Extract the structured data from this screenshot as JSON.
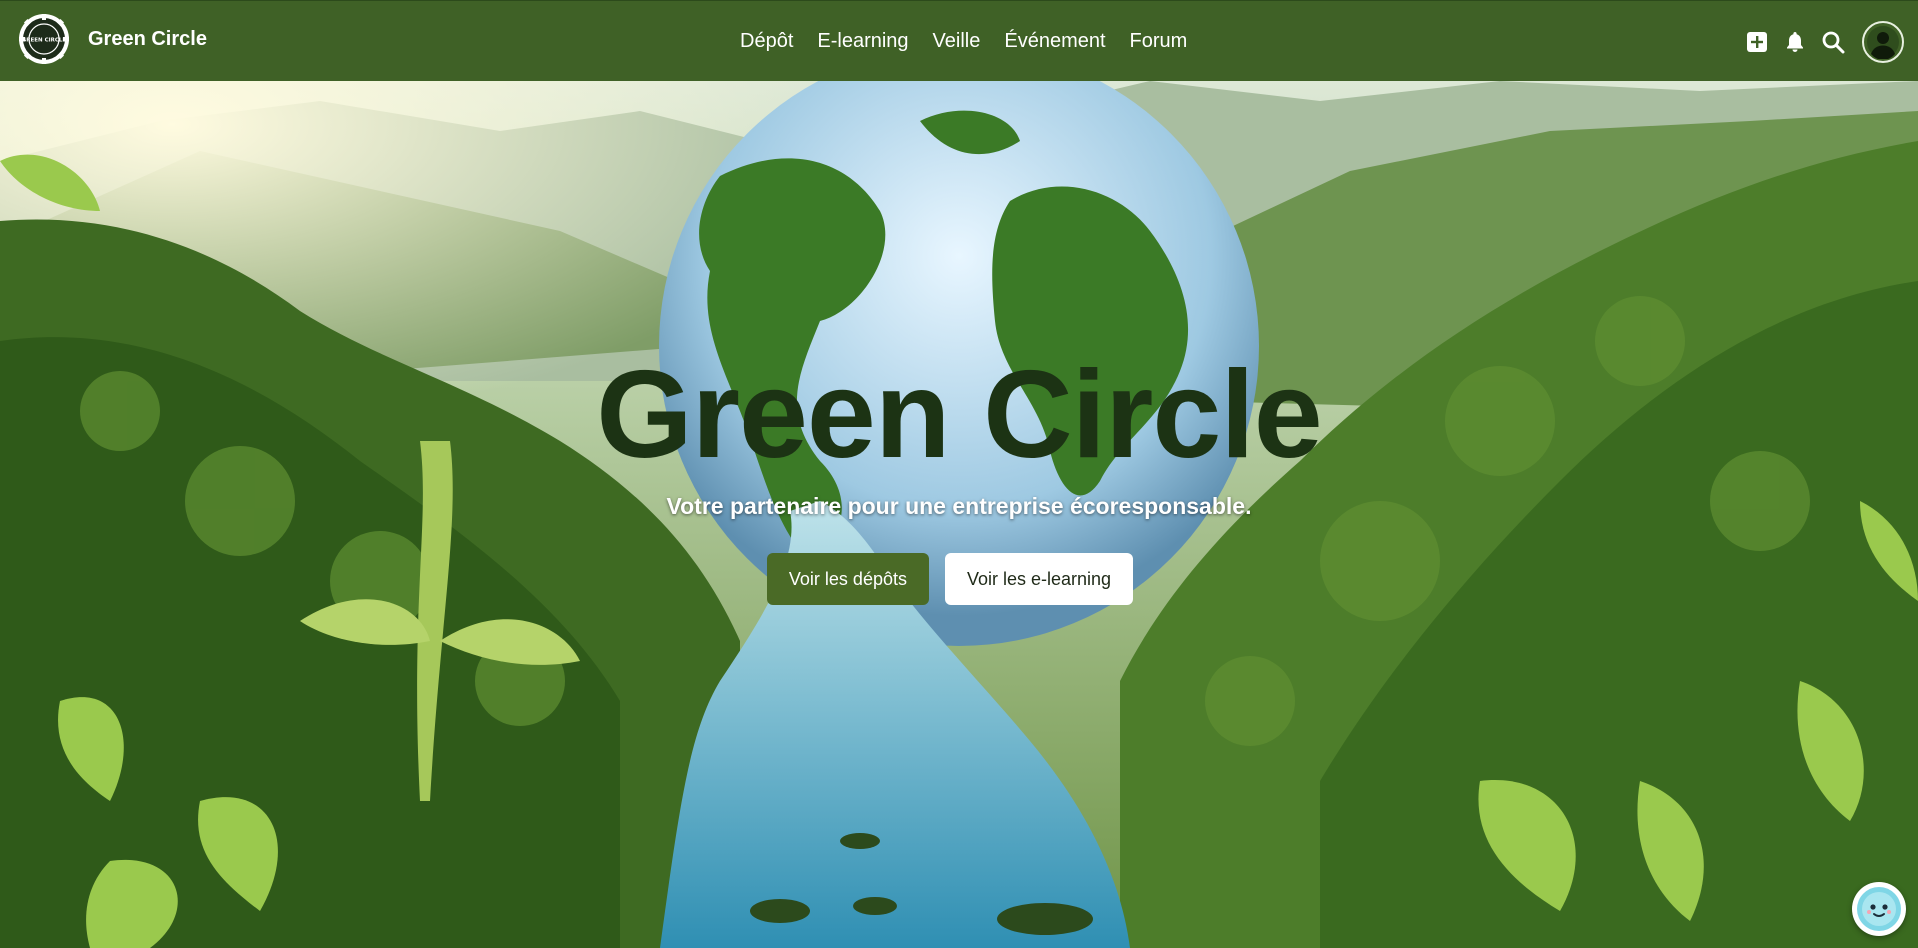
{
  "brand": {
    "name": "Green Circle",
    "logo_text": "GREEN CIRCLE"
  },
  "nav": {
    "links": [
      "Dépôt",
      "E-learning",
      "Veille",
      "Événement",
      "Forum"
    ],
    "icons": [
      "plus-square-icon",
      "bell-icon",
      "search-icon",
      "user-avatar-icon"
    ]
  },
  "hero": {
    "title": "Green Circle",
    "subtitle": "Votre partenaire pour une entreprise écoresponsable.",
    "primary_button": "Voir les dépôts",
    "secondary_button": "Voir les e-learning"
  },
  "chat": {
    "icon": "chatbot-mascot-icon"
  },
  "colors": {
    "navbar": "#3f6126",
    "primary_button": "#4a6a26",
    "title": "#1c3314"
  }
}
